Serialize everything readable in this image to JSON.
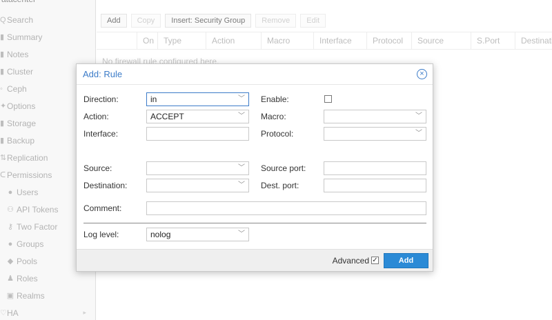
{
  "sidebar": {
    "datacenter": "atacenter",
    "items": [
      {
        "icon": "search-icon",
        "glyph": "Q",
        "label": "Search",
        "sub": false
      },
      {
        "icon": "book-icon",
        "glyph": "▮",
        "label": "Summary",
        "sub": false
      },
      {
        "icon": "notes-icon",
        "glyph": "▮",
        "label": "Notes",
        "sub": false
      },
      {
        "icon": "server-icon",
        "glyph": "▮",
        "label": "Cluster",
        "sub": false
      },
      {
        "icon": "ceph-icon",
        "glyph": "◦",
        "label": "Ceph",
        "sub": false
      },
      {
        "icon": "gear-icon",
        "glyph": "✦",
        "label": "Options",
        "sub": false
      },
      {
        "icon": "database-icon",
        "glyph": "▮",
        "label": "Storage",
        "sub": false
      },
      {
        "icon": "backup-icon",
        "glyph": "▮",
        "label": "Backup",
        "sub": false
      },
      {
        "icon": "replication-icon",
        "glyph": "⇅",
        "label": "Replication",
        "sub": false
      },
      {
        "icon": "unlock-icon",
        "glyph": "ᑕ",
        "label": "Permissions",
        "sub": false
      },
      {
        "icon": "user-icon",
        "glyph": "●",
        "label": "Users",
        "sub": true
      },
      {
        "icon": "user-tag-icon",
        "glyph": "⚇",
        "label": "API Tokens",
        "sub": true
      },
      {
        "icon": "key-icon",
        "glyph": "⚷",
        "label": "Two Factor",
        "sub": true
      },
      {
        "icon": "users-icon",
        "glyph": "●",
        "label": "Groups",
        "sub": true
      },
      {
        "icon": "tags-icon",
        "glyph": "◆",
        "label": "Pools",
        "sub": true
      },
      {
        "icon": "male-icon",
        "glyph": "♟",
        "label": "Roles",
        "sub": true
      },
      {
        "icon": "address-book-icon",
        "glyph": "▣",
        "label": "Realms",
        "sub": true
      },
      {
        "icon": "heartbeat-icon",
        "glyph": "♡",
        "label": "HA",
        "sub": false
      }
    ]
  },
  "toolbar": {
    "add": "Add",
    "copy": "Copy",
    "insert_group": "Insert: Security Group",
    "remove": "Remove",
    "edit": "Edit"
  },
  "grid": {
    "columns": [
      "On",
      "Type",
      "Action",
      "Macro",
      "Interface",
      "Protocol",
      "Source",
      "S.Port",
      "Destinatio"
    ],
    "empty_text": "No firewall rule configured here."
  },
  "dialog": {
    "title": "Add: Rule",
    "direction": {
      "label": "Direction:",
      "value": "in"
    },
    "enable": {
      "label": "Enable:",
      "checked": false
    },
    "action": {
      "label": "Action:",
      "value": "ACCEPT"
    },
    "macro": {
      "label": "Macro:",
      "value": ""
    },
    "interface": {
      "label": "Interface:",
      "value": ""
    },
    "protocol": {
      "label": "Protocol:",
      "value": ""
    },
    "source": {
      "label": "Source:",
      "value": ""
    },
    "source_port": {
      "label": "Source port:",
      "value": ""
    },
    "destination": {
      "label": "Destination:",
      "value": ""
    },
    "dest_port": {
      "label": "Dest. port:",
      "value": ""
    },
    "comment": {
      "label": "Comment:",
      "value": ""
    },
    "log_level": {
      "label": "Log level:",
      "value": "nolog"
    },
    "advanced": {
      "label": "Advanced",
      "checked": true
    },
    "add_button": "Add"
  }
}
